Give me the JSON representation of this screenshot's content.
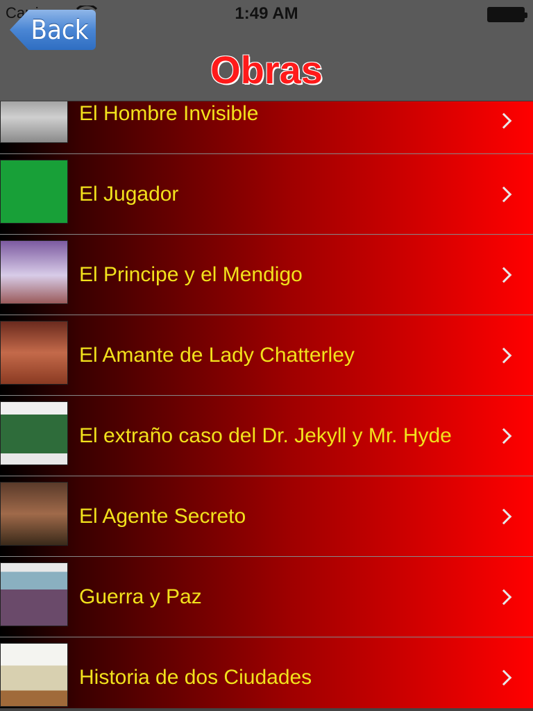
{
  "status_bar": {
    "carrier": "Carrier",
    "time": "1:49 AM"
  },
  "nav": {
    "back_label": "Back",
    "title": "Obras"
  },
  "items": [
    {
      "label": "El Hombre Invisible"
    },
    {
      "label": "El Jugador"
    },
    {
      "label": "El Principe y el Mendigo"
    },
    {
      "label": "El Amante de Lady Chatterley"
    },
    {
      "label": "El extraño caso del Dr. Jekyll y Mr. Hyde"
    },
    {
      "label": "El Agente Secreto"
    },
    {
      "label": "Guerra y Paz"
    },
    {
      "label": "Historia de dos Ciudades"
    }
  ],
  "colors": {
    "title": "#ff1a1a",
    "item_text": "#f2e21c",
    "row_gradient_end": "#ff0000"
  }
}
